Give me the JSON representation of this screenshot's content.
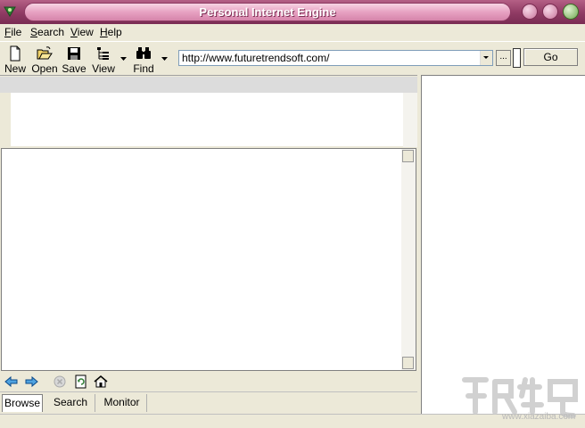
{
  "window": {
    "title": "Personal Internet Engine",
    "accent_color": "#a3487a"
  },
  "menubar": {
    "items": [
      {
        "label": "File",
        "mnemonic": "F"
      },
      {
        "label": "Search",
        "mnemonic": "S"
      },
      {
        "label": "View",
        "mnemonic": "V"
      },
      {
        "label": "Help",
        "mnemonic": "H"
      }
    ]
  },
  "toolbar": {
    "new_label": "New",
    "open_label": "Open",
    "save_label": "Save",
    "view_label": "View",
    "find_label": "Find"
  },
  "address": {
    "url": "http://www.futuretrendsoft.com/",
    "more_label": "...",
    "go_label": "Go"
  },
  "tabs": [
    {
      "label": "Browse",
      "active": true
    },
    {
      "label": "Search",
      "active": false
    },
    {
      "label": "Monitor",
      "active": false
    }
  ],
  "watermark": {
    "domain": "www.xiazaiba.com"
  }
}
